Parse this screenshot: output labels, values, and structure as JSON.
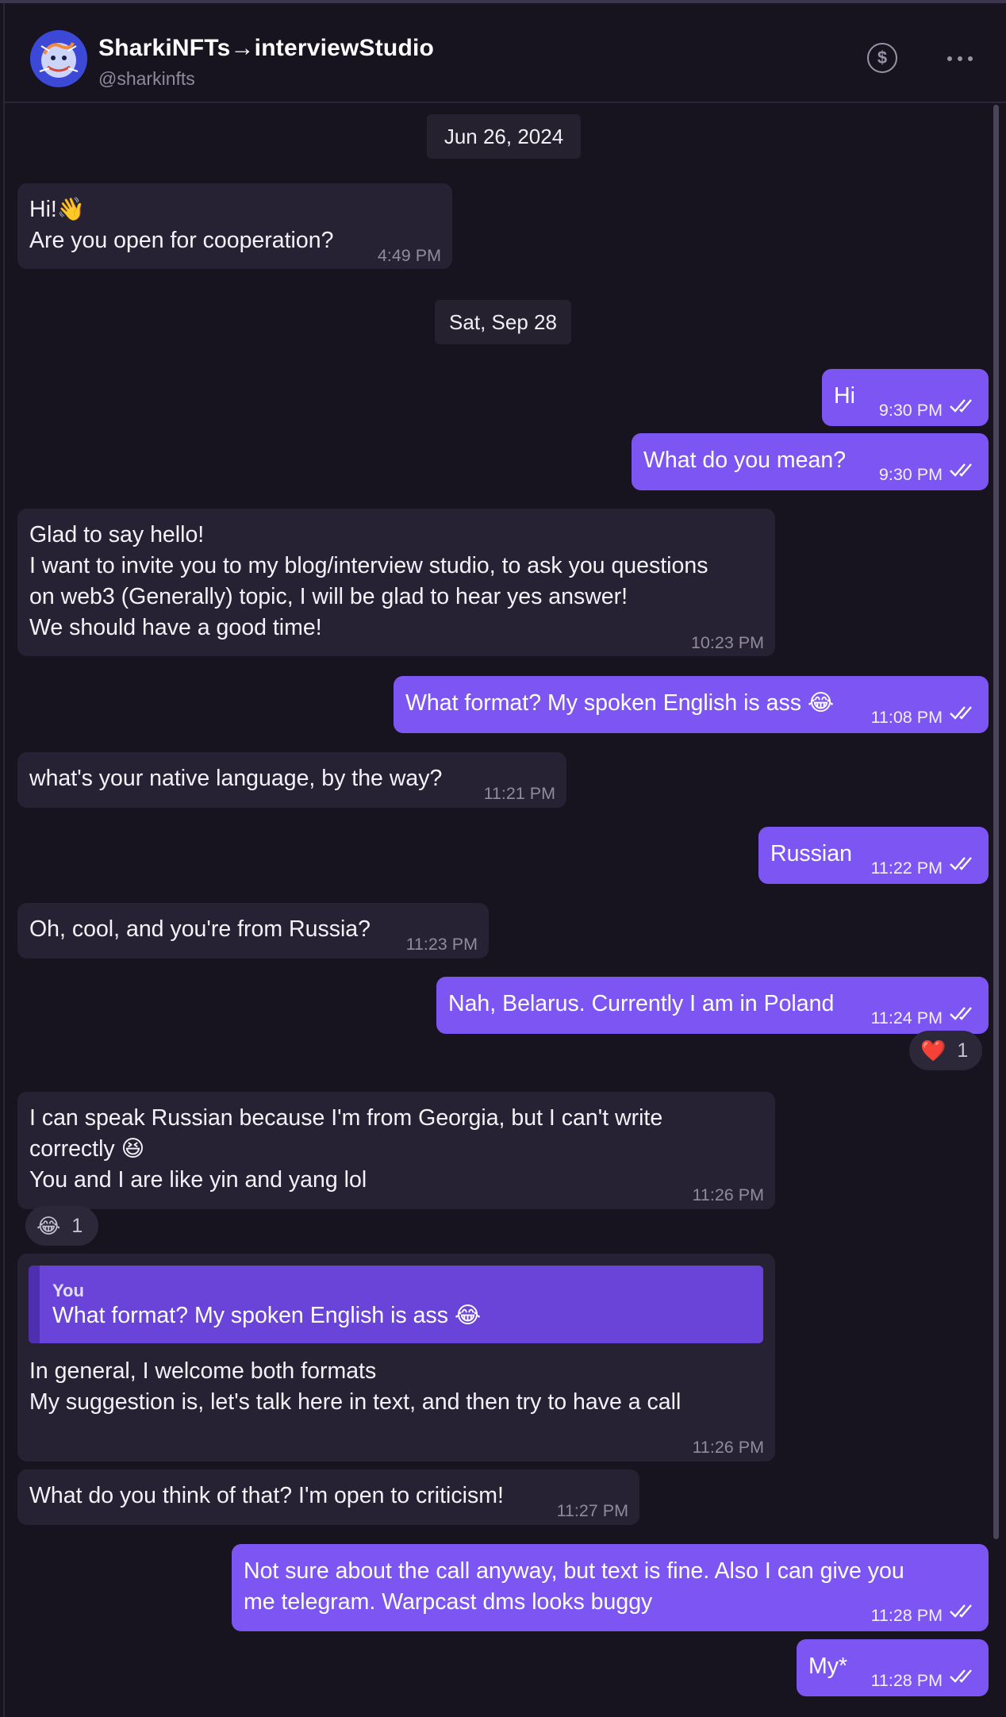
{
  "header": {
    "title": "SharkiNFTs→interviewStudio",
    "handle": "@sharkinfts",
    "dollar_symbol": "$"
  },
  "icons": {
    "dollar": "dollar-circle-icon",
    "more": "more-horizontal-icon",
    "read_receipt": "double-check-icon"
  },
  "colors": {
    "background": "#17141f",
    "incoming_bubble": "#272233",
    "outgoing_bubble": "#7d55f3",
    "quote_block": "#6a43d8"
  },
  "dates": [
    "Jun 26, 2024",
    "Sat, Sep 28"
  ],
  "messages": [
    {
      "lines": [
        "Hi!👋",
        "Are you open for cooperation?"
      ],
      "time": "4:49 PM"
    },
    {
      "lines": [
        "Hi"
      ],
      "time": "9:30 PM"
    },
    {
      "lines": [
        "What do you mean?"
      ],
      "time": "9:30 PM"
    },
    {
      "lines": [
        "Glad to say hello!",
        "I want to invite you to my blog/interview studio, to ask you questions",
        "on web3 (Generally) topic, I will be glad to hear yes answer!",
        "We should have a good time!"
      ],
      "time": "10:23 PM"
    },
    {
      "lines": [
        "What format? My spoken English is ass 😂"
      ],
      "time": "11:08 PM"
    },
    {
      "lines": [
        "what's your native language, by the way?"
      ],
      "time": "11:21 PM"
    },
    {
      "lines": [
        "Russian"
      ],
      "time": "11:22 PM"
    },
    {
      "lines": [
        "Oh, cool, and you're from Russia?"
      ],
      "time": "11:23 PM"
    },
    {
      "lines": [
        "Nah, Belarus. Currently I am in Poland"
      ],
      "time": "11:24 PM",
      "reaction": {
        "emoji": "❤️",
        "count": "1"
      }
    },
    {
      "lines": [
        "I can speak Russian because I'm from Georgia, but I can't write",
        "correctly 😆",
        "You and I are like yin and yang lol"
      ],
      "time": "11:26 PM",
      "reaction": {
        "emoji": "😂",
        "count": "1"
      }
    },
    {
      "quote": {
        "author": "You",
        "text": "What format? My spoken English is ass 😂"
      },
      "lines": [
        "In general, I welcome both formats",
        "My suggestion is, let's talk here in text, and then try to have a call"
      ],
      "time": "11:26 PM"
    },
    {
      "lines": [
        "What do you think of that? I'm open to criticism!"
      ],
      "time": "11:27 PM"
    },
    {
      "lines": [
        "Not sure about the call anyway, but text is fine. Also I can give you",
        "me telegram. Warpcast dms looks buggy"
      ],
      "time": "11:28 PM"
    },
    {
      "lines": [
        "My*"
      ],
      "time": "11:28 PM"
    }
  ]
}
